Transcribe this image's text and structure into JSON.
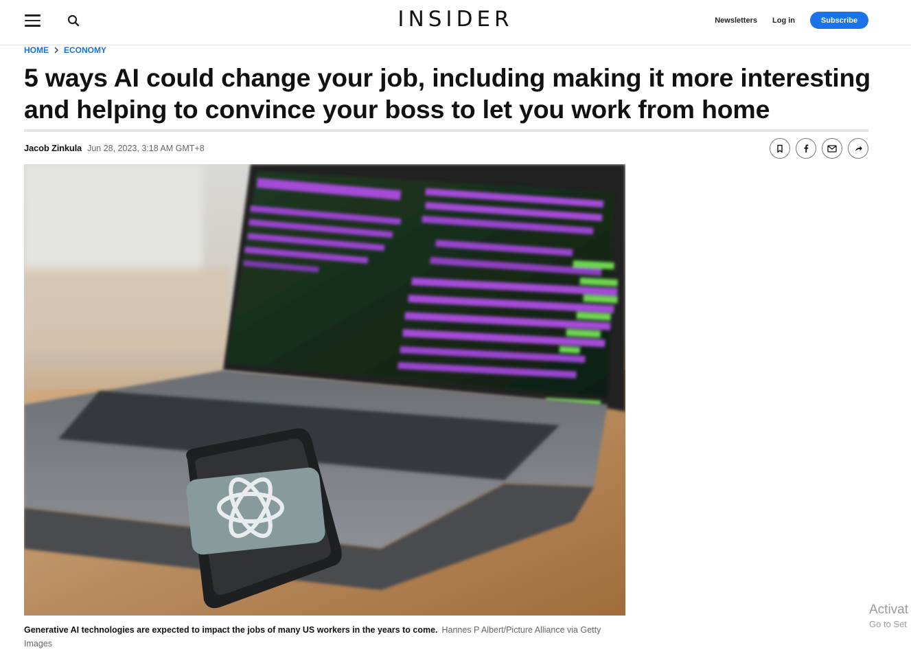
{
  "header": {
    "logo": "INSIDER",
    "newsletters": "Newsletters",
    "login": "Log in",
    "subscribe": "Subscribe",
    "accent_color": "#1a73e8"
  },
  "breadcrumb": {
    "home": "HOME",
    "section": "ECONOMY"
  },
  "article": {
    "headline": "5 ways AI could change your job, including making it more interesting and helping to convince your boss to let you work from home",
    "author": "Jacob Zinkula",
    "date": "Jun 28, 2023, 3:18 AM GMT+8",
    "share_icons": [
      "bookmark-icon",
      "facebook-icon",
      "email-icon",
      "share-arrow-icon"
    ],
    "image": {
      "description_icon": "photo-laptop-phone",
      "caption": "Generative AI technologies are expected to impact the jobs of many US workers in the years to come.",
      "credit": "Hannes P Albert/Picture Alliance via Getty Images"
    }
  },
  "watermark": {
    "line1": "Activat",
    "line2": "Go to Set"
  }
}
